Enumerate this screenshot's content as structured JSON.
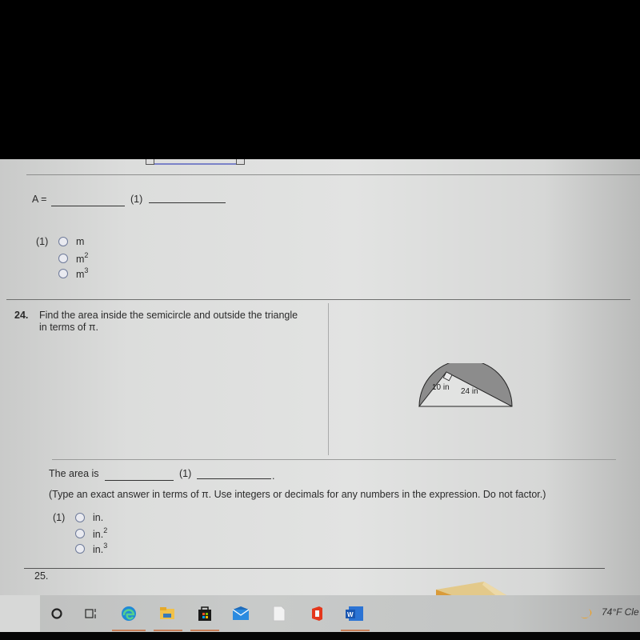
{
  "previous_question": {
    "answer_label": "A =",
    "unit_marker": "(1)",
    "unit_options": {
      "prefix": "(1)",
      "options": [
        {
          "base": "m",
          "exp": ""
        },
        {
          "base": "m",
          "exp": "2"
        },
        {
          "base": "m",
          "exp": "3"
        }
      ]
    }
  },
  "question_24": {
    "number": "24.",
    "prompt_line1": "Find the area inside the semicircle and outside the triangle",
    "prompt_line2": "in terms of π.",
    "figure": {
      "leg_short_label": "10 in",
      "leg_long_label": "24 in",
      "shape": "semicircle with inscribed right triangle; shaded regions outside triangle"
    },
    "answer_prefix": "The area is",
    "unit_marker": "(1)",
    "answer_suffix": ".",
    "instructions": "(Type an exact answer in terms of π. Use integers or decimals for any numbers in the expression. Do not factor.)",
    "unit_options": {
      "prefix": "(1)",
      "options": [
        {
          "base": "in.",
          "exp": ""
        },
        {
          "base": "in.",
          "exp": "2"
        },
        {
          "base": "in.",
          "exp": "3"
        }
      ]
    }
  },
  "question_25": {
    "number": "25."
  },
  "taskbar": {
    "icons": [
      "search-circle-icon",
      "task-view-icon",
      "edge-icon",
      "file-explorer-icon",
      "store-icon",
      "mail-icon",
      "document-icon",
      "office-icon",
      "word-icon"
    ],
    "weather": {
      "temperature": "74°F",
      "condition": "Cle"
    }
  },
  "colors": {
    "shaded_region": "#8c8c8c",
    "radio_border": "#6f7b9a",
    "screen_bg": "#e0e1e0"
  }
}
